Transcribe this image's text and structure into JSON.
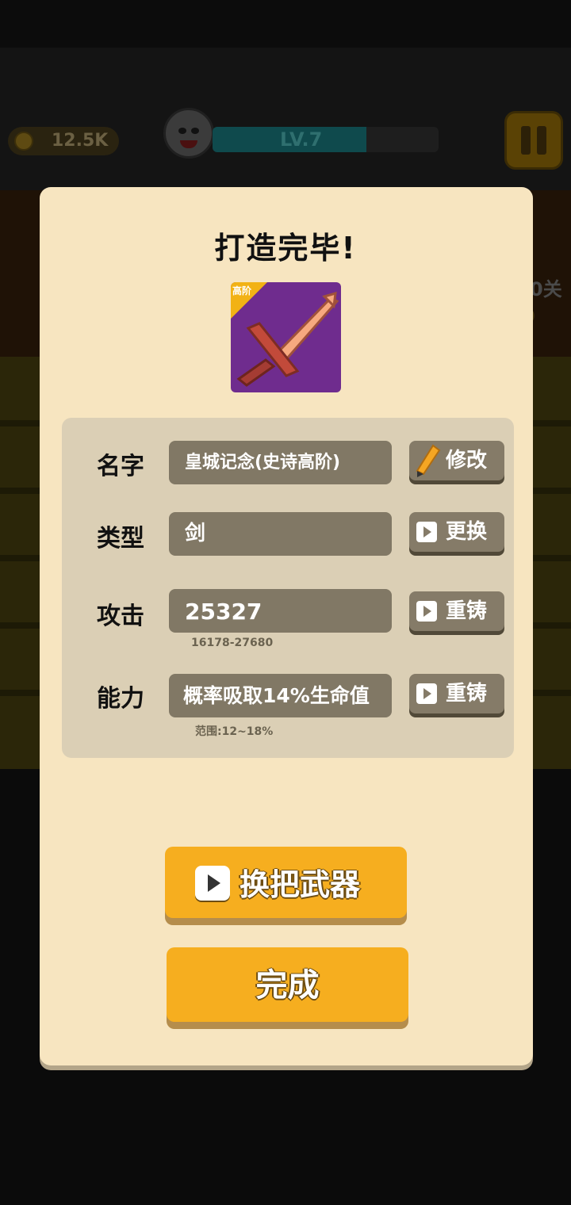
{
  "hud": {
    "coins": "12.5K",
    "level": "LV.7",
    "level_progress": 0.68,
    "side_text": "0关",
    "side_text2": "0"
  },
  "modal": {
    "title": "打造完毕!",
    "weapon": {
      "tier_label": "高阶",
      "icon": "sword-icon",
      "card_color": "#6f2c8e"
    },
    "rows": {
      "name": {
        "label": "名字",
        "value": "皇城记念(史诗高阶)",
        "button": "修改"
      },
      "type": {
        "label": "类型",
        "value": "剑",
        "button": "更换"
      },
      "attack": {
        "label": "攻击",
        "value": "25327",
        "range": "16178-27680",
        "button": "重铸"
      },
      "ability": {
        "label": "能力",
        "value": "概率吸取14%生命值",
        "range": "范围:12~18%",
        "button": "重铸"
      }
    },
    "switch_button": "换把武器",
    "done_button": "完成"
  },
  "colors": {
    "accent": "#f6ae1f",
    "panel": "#f7e5c0",
    "field": "#817865"
  }
}
